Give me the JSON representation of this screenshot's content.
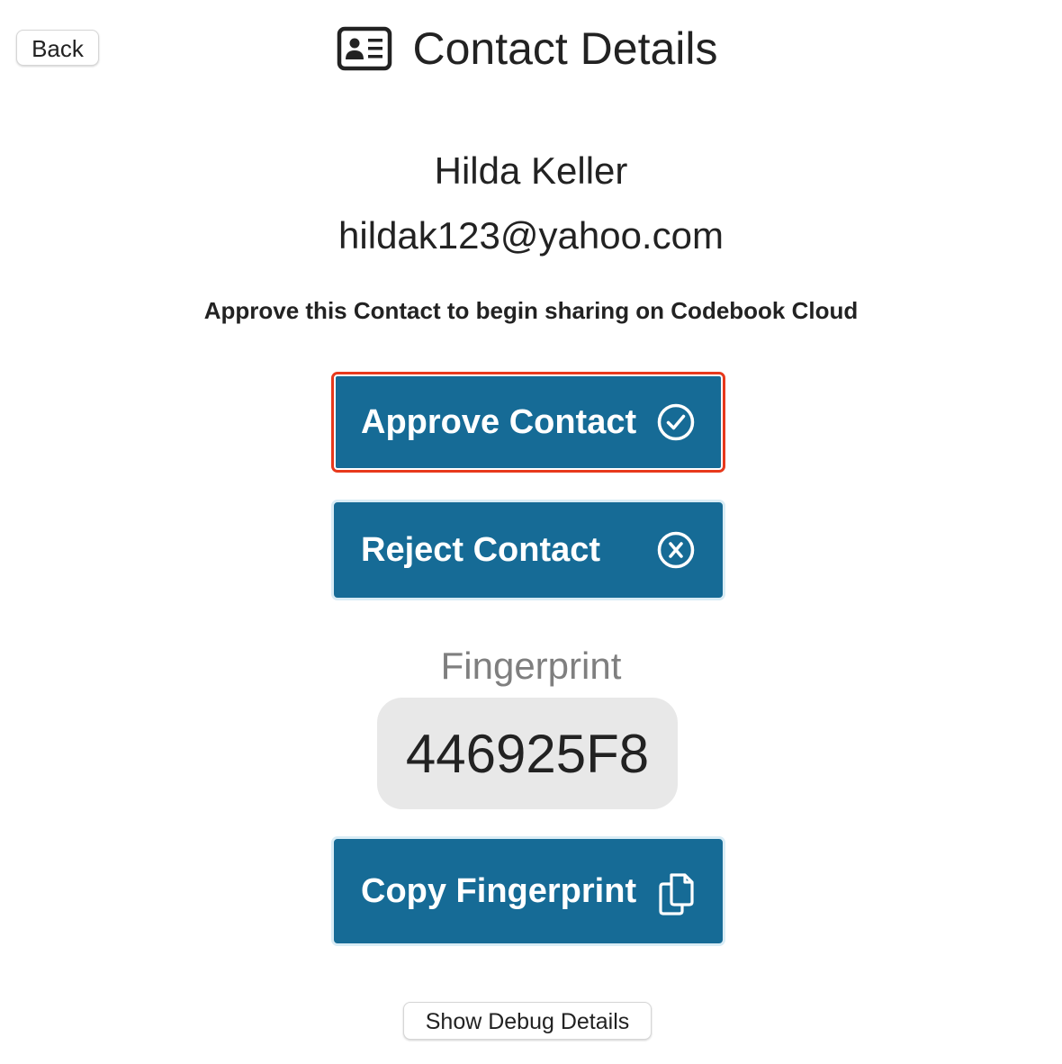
{
  "nav": {
    "back_label": "Back"
  },
  "header": {
    "title": "Contact Details",
    "icon": "contact-card-icon"
  },
  "contact": {
    "name": "Hilda Keller",
    "email": "hildak123@yahoo.com"
  },
  "instruction": "Approve this Contact to begin sharing on Codebook Cloud",
  "actions": {
    "approve_label": "Approve Contact",
    "approve_icon": "check-circle-icon",
    "reject_label": "Reject Contact",
    "reject_icon": "x-circle-icon"
  },
  "fingerprint": {
    "label": "Fingerprint",
    "value": "446925F8",
    "copy_label": "Copy Fingerprint",
    "copy_icon": "copy-documents-icon"
  },
  "debug": {
    "label": "Show Debug Details"
  },
  "colors": {
    "button_blue": "#166b96",
    "highlight_border": "#e8391c",
    "fingerprint_bg": "#e8e8e8",
    "muted_text": "#7f7f7f"
  }
}
